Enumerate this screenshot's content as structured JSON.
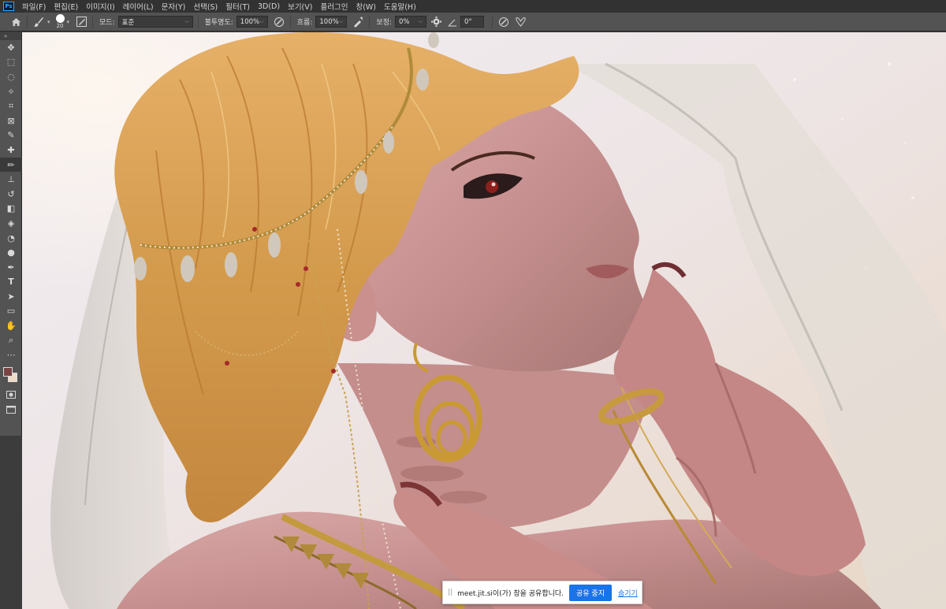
{
  "app": {
    "logo": "Ps",
    "menus": [
      "파일(F)",
      "편집(E)",
      "이미지(I)",
      "레이어(L)",
      "문자(Y)",
      "선택(S)",
      "필터(T)",
      "3D(D)",
      "보기(V)",
      "플러그인",
      "창(W)",
      "도움말(H)"
    ]
  },
  "options": {
    "brush_size": "20",
    "mode_label": "모드:",
    "mode_value": "표준",
    "opacity_label": "불투명도:",
    "opacity_value": "100%",
    "flow_label": "흐름:",
    "flow_value": "100%",
    "smoothing_label": "보정:",
    "smoothing_value": "0%",
    "angle_value": "0°"
  },
  "toolbar": {
    "collapse_glyph": "»",
    "tools": [
      {
        "name": "move-tool",
        "glyph": "✥"
      },
      {
        "name": "marquee-tool",
        "glyph": "⬚"
      },
      {
        "name": "lasso-tool",
        "glyph": "◌"
      },
      {
        "name": "magic-wand-tool",
        "glyph": "✧"
      },
      {
        "name": "crop-tool",
        "glyph": "⌗"
      },
      {
        "name": "frame-tool",
        "glyph": "⊠"
      },
      {
        "name": "eyedropper-tool",
        "glyph": "✎"
      },
      {
        "name": "healing-brush-tool",
        "glyph": "✚"
      },
      {
        "name": "brush-tool",
        "glyph": "✏"
      },
      {
        "name": "clone-stamp-tool",
        "glyph": "⊥"
      },
      {
        "name": "history-brush-tool",
        "glyph": "↺"
      },
      {
        "name": "eraser-tool",
        "glyph": "◧"
      },
      {
        "name": "paint-bucket-tool",
        "glyph": "◈"
      },
      {
        "name": "blur-tool",
        "glyph": "◔"
      },
      {
        "name": "dodge-tool",
        "glyph": "●"
      },
      {
        "name": "pen-tool",
        "glyph": "✒"
      },
      {
        "name": "type-tool",
        "glyph": "T"
      },
      {
        "name": "path-selection-tool",
        "glyph": "➤"
      },
      {
        "name": "rectangle-tool",
        "glyph": "▭"
      },
      {
        "name": "hand-tool",
        "glyph": "✋"
      },
      {
        "name": "zoom-tool",
        "glyph": "⌕"
      },
      {
        "name": "more-tools",
        "glyph": "⋯"
      }
    ],
    "active_tool": "brush-tool",
    "foreground_color": "#7a4444",
    "background_color": "#f1dcc6"
  },
  "share_banner": {
    "grip": "||",
    "message": "meet.jit.si이(가) 창을 공유합니다.",
    "stop_label": "공유 중지",
    "hide_label": "숨기기"
  },
  "colors": {
    "menubar_bg": "#323232",
    "panel_bg": "#535353",
    "accent": "#1a73e8"
  }
}
